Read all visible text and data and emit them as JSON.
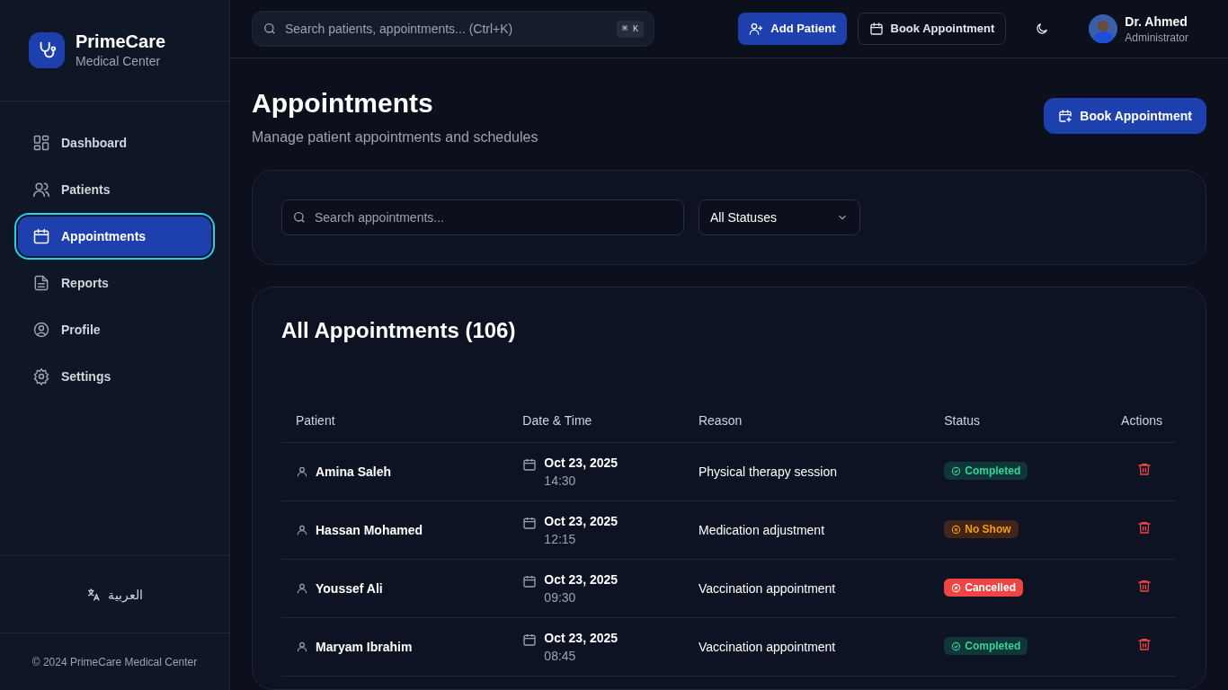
{
  "brand": {
    "name": "PrimeCare",
    "subtitle": "Medical Center"
  },
  "sidebar": {
    "items": [
      {
        "label": "Dashboard",
        "kind": "dashboard",
        "selected": false
      },
      {
        "label": "Patients",
        "kind": "patients",
        "selected": false
      },
      {
        "label": "Appointments",
        "kind": "appointments",
        "selected": true
      },
      {
        "label": "Reports",
        "kind": "reports",
        "selected": false
      },
      {
        "label": "Profile",
        "kind": "profile",
        "selected": false
      },
      {
        "label": "Settings",
        "kind": "settings",
        "selected": false
      }
    ],
    "language": "العربية",
    "copyright": "© 2024 PrimeCare Medical Center"
  },
  "topbar": {
    "search_placeholder": "Search patients, appointments... (Ctrl+K)",
    "shortcut": "⌘ K",
    "add_patient": "Add Patient",
    "book_appointment": "Book Appointment",
    "user_name": "Dr. Ahmed",
    "user_role": "Administrator"
  },
  "page": {
    "title": "Appointments",
    "subtitle": "Manage patient appointments and schedules",
    "book_button": "Book Appointment"
  },
  "filters": {
    "search_placeholder": "Search appointments...",
    "status_filter": "All Statuses"
  },
  "table": {
    "title": "All Appointments (106)",
    "columns": [
      "Patient",
      "Date & Time",
      "Reason",
      "Status",
      "Actions"
    ],
    "rows": [
      {
        "patient": "Amina Saleh",
        "date": "Oct 23, 2025",
        "time": "14:30",
        "reason": "Physical therapy session",
        "status": "Completed",
        "kind": "completed"
      },
      {
        "patient": "Hassan Mohamed",
        "date": "Oct 23, 2025",
        "time": "12:15",
        "reason": "Medication adjustment",
        "status": "No Show",
        "kind": "no_show"
      },
      {
        "patient": "Youssef Ali",
        "date": "Oct 23, 2025",
        "time": "09:30",
        "reason": "Vaccination appointment",
        "status": "Cancelled",
        "kind": "cancelled"
      },
      {
        "patient": "Maryam Ibrahim",
        "date": "Oct 23, 2025",
        "time": "08:45",
        "reason": "Vaccination appointment",
        "status": "Completed",
        "kind": "completed"
      }
    ]
  }
}
